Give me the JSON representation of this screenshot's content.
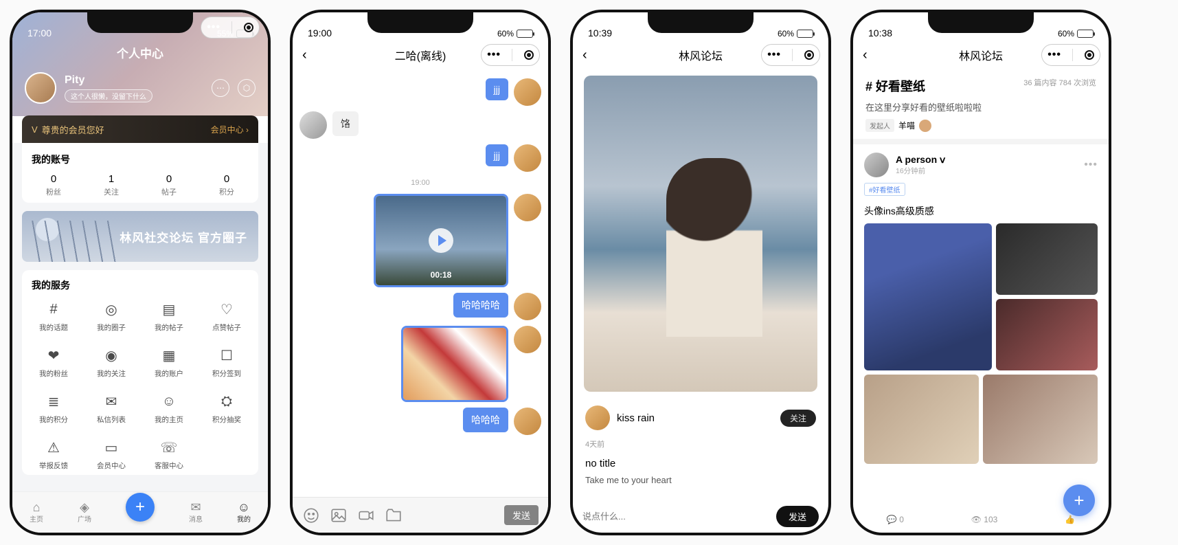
{
  "screen1": {
    "status": {
      "time": "17:00",
      "battery_pct": "55%",
      "battery_fill": 55
    },
    "title": "个人中心",
    "user": {
      "name": "Pity",
      "bio": "这个人很懒，没留下什么"
    },
    "vip": {
      "greeting": "尊贵的会员您好",
      "link": "会员中心"
    },
    "account_section": "我的账号",
    "stats": [
      {
        "num": "0",
        "label": "粉丝"
      },
      {
        "num": "1",
        "label": "关注"
      },
      {
        "num": "0",
        "label": "帖子"
      },
      {
        "num": "0",
        "label": "积分"
      }
    ],
    "banner": "林风社交论坛 官方圈子",
    "services_section": "我的服务",
    "services": [
      "我的话题",
      "我的圈子",
      "我的帖子",
      "点赞帖子",
      "我的粉丝",
      "我的关注",
      "我的账户",
      "积分签到",
      "我的积分",
      "私信列表",
      "我的主页",
      "积分抽奖",
      "举报反馈",
      "会员中心",
      "客服中心"
    ],
    "tabs": [
      "主页",
      "广场",
      "",
      "消息",
      "我的"
    ]
  },
  "screen2": {
    "status": {
      "time": "19:00",
      "battery_pct": "60%"
    },
    "title": "二哈(离线)",
    "messages": [
      {
        "side": "mine",
        "text": "jjj"
      },
      {
        "side": "other",
        "text": "饹"
      },
      {
        "side": "mine",
        "text": "jjj"
      }
    ],
    "time_sep": "19:00",
    "video_duration": "00:18",
    "msg_haha4": "哈哈哈哈",
    "msg_haha3": "哈哈哈",
    "send": "发送"
  },
  "screen3": {
    "status": {
      "time": "10:39",
      "battery_pct": "60%"
    },
    "title": "林风论坛",
    "author": "kiss rain",
    "follow": "关注",
    "time_ago": "4天前",
    "post_title": "no title",
    "post_sub": "Take me to your heart",
    "placeholder": "说点什么...",
    "send": "发送"
  },
  "screen4": {
    "status": {
      "time": "10:38",
      "battery_pct": "60%"
    },
    "title": "林风论坛",
    "topic": "# 好看壁纸",
    "topic_meta": "36 篇内容   784 次浏览",
    "topic_desc": "在这里分享好看的壁纸啦啦啦",
    "owner_label": "发起人",
    "owner_name": "羊喵",
    "post": {
      "author": "A person ⅴ",
      "time": "16分钟前",
      "tag": "#好看壁纸",
      "body": "头像ins高级质感"
    },
    "bar": {
      "comments": "0",
      "views": "103"
    }
  }
}
